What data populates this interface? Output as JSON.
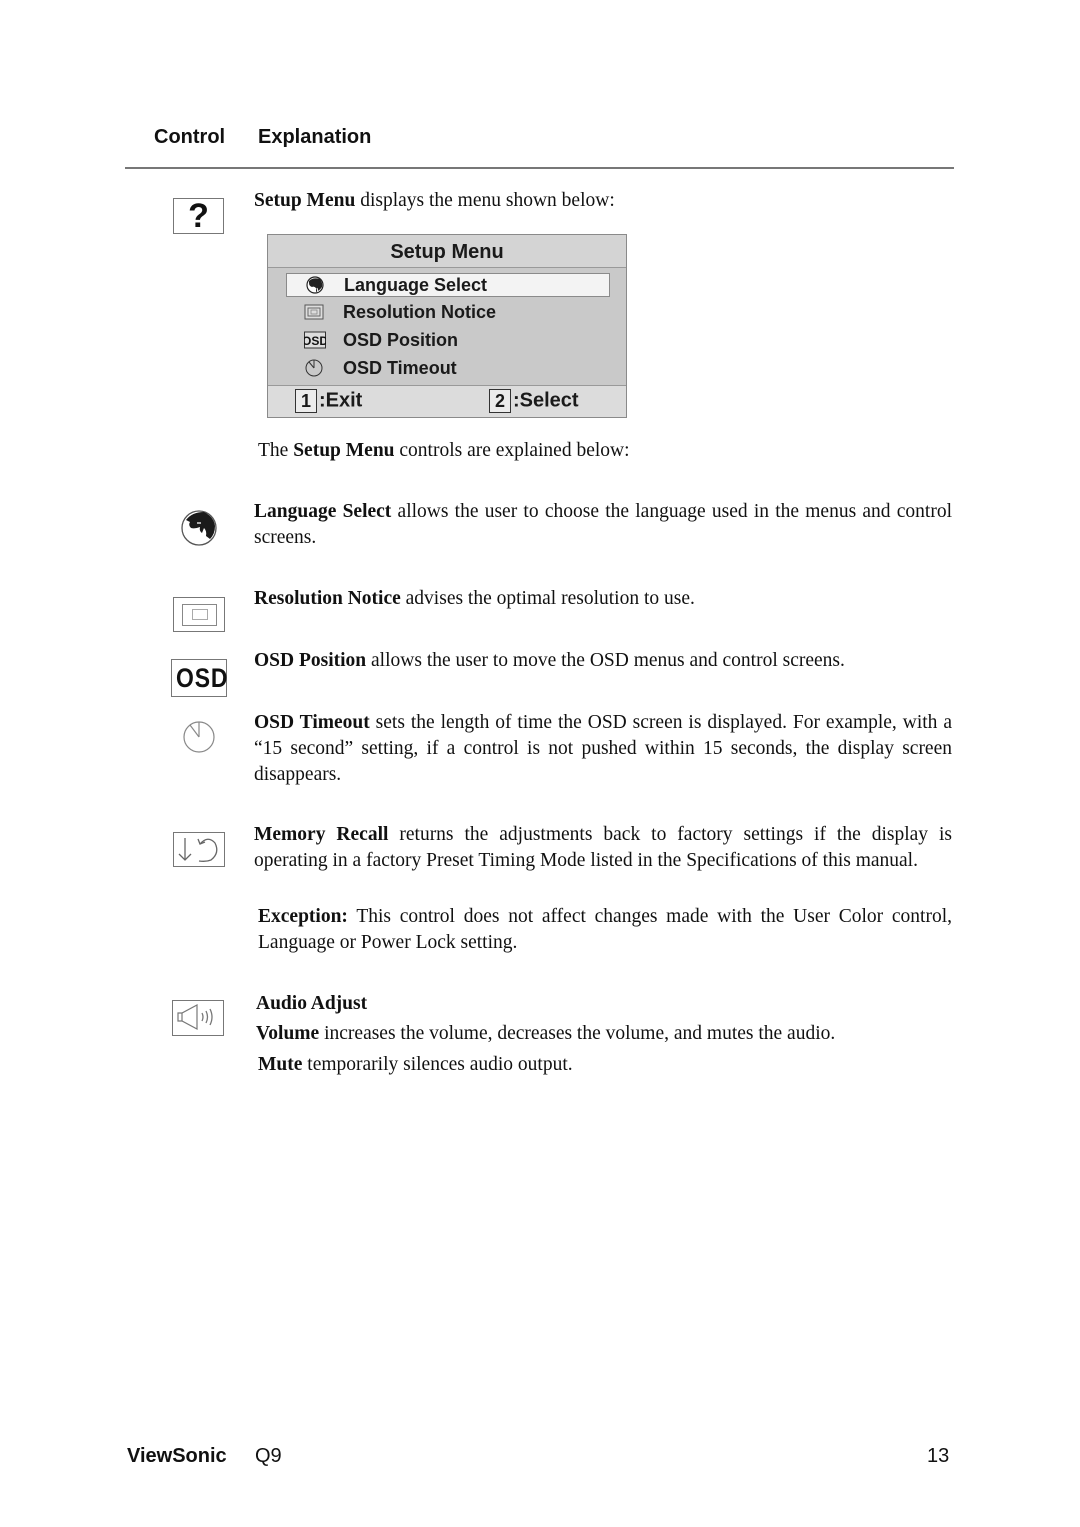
{
  "header": {
    "control_label": "Control",
    "explanation_label": "Explanation"
  },
  "intro": {
    "bold": "Setup Menu",
    "text": " displays the menu shown below:"
  },
  "osd_menu": {
    "title": "Setup Menu",
    "items": [
      {
        "label": "Language Select",
        "icon": "globe-icon",
        "selected": true
      },
      {
        "label": "Resolution Notice",
        "icon": "resolution-notice-icon",
        "selected": false
      },
      {
        "label": "OSD Position",
        "icon": "osd-icon",
        "selected": false
      },
      {
        "label": "OSD Timeout",
        "icon": "clock-icon",
        "selected": false
      }
    ],
    "footer": {
      "exit_key": "1",
      "exit_label": ":Exit",
      "select_key": "2",
      "select_label": ":Select"
    }
  },
  "explain_intro": {
    "pre": "The ",
    "bold": "Setup Menu",
    "post": " controls are explained below:"
  },
  "entries": [
    {
      "icon": "globe-icon",
      "bold": "Language Select",
      "text": " allows the user to choose the language used in the menus and control screens."
    },
    {
      "icon": "resolution-notice-icon",
      "bold": "Resolution Notice",
      "text": " advises the optimal resolution to use."
    },
    {
      "icon": "osd-icon",
      "bold": "OSD Position",
      "text": " allows the user to move the OSD menus and control screens."
    },
    {
      "icon": "clock-icon",
      "bold": "OSD Timeout",
      "text": " sets the length of time the OSD screen is displayed. For example, with a “15 second” setting, if a control is not pushed within 15 seconds, the display screen disappears."
    },
    {
      "icon": "memory-recall-icon",
      "bold": "Memory Recall",
      "text": " returns the adjustments back to factory settings if the display is operating in a factory Preset Timing Mode listed in the Specifications of this manual."
    }
  ],
  "exception": {
    "bold": "Exception:",
    "text": " This control does not affect changes made with the User Color control, Language or Power Lock setting."
  },
  "audio": {
    "icon": "speaker-icon",
    "heading": "Audio Adjust",
    "volume_bold": "Volume",
    "volume_text": " increases the volume, decreases the volume, and mutes the audio.",
    "mute_bold": "Mute",
    "mute_text": " temporarily silences audio output."
  },
  "footer": {
    "brand": "ViewSonic",
    "model": "Q9",
    "page_number": "13"
  }
}
